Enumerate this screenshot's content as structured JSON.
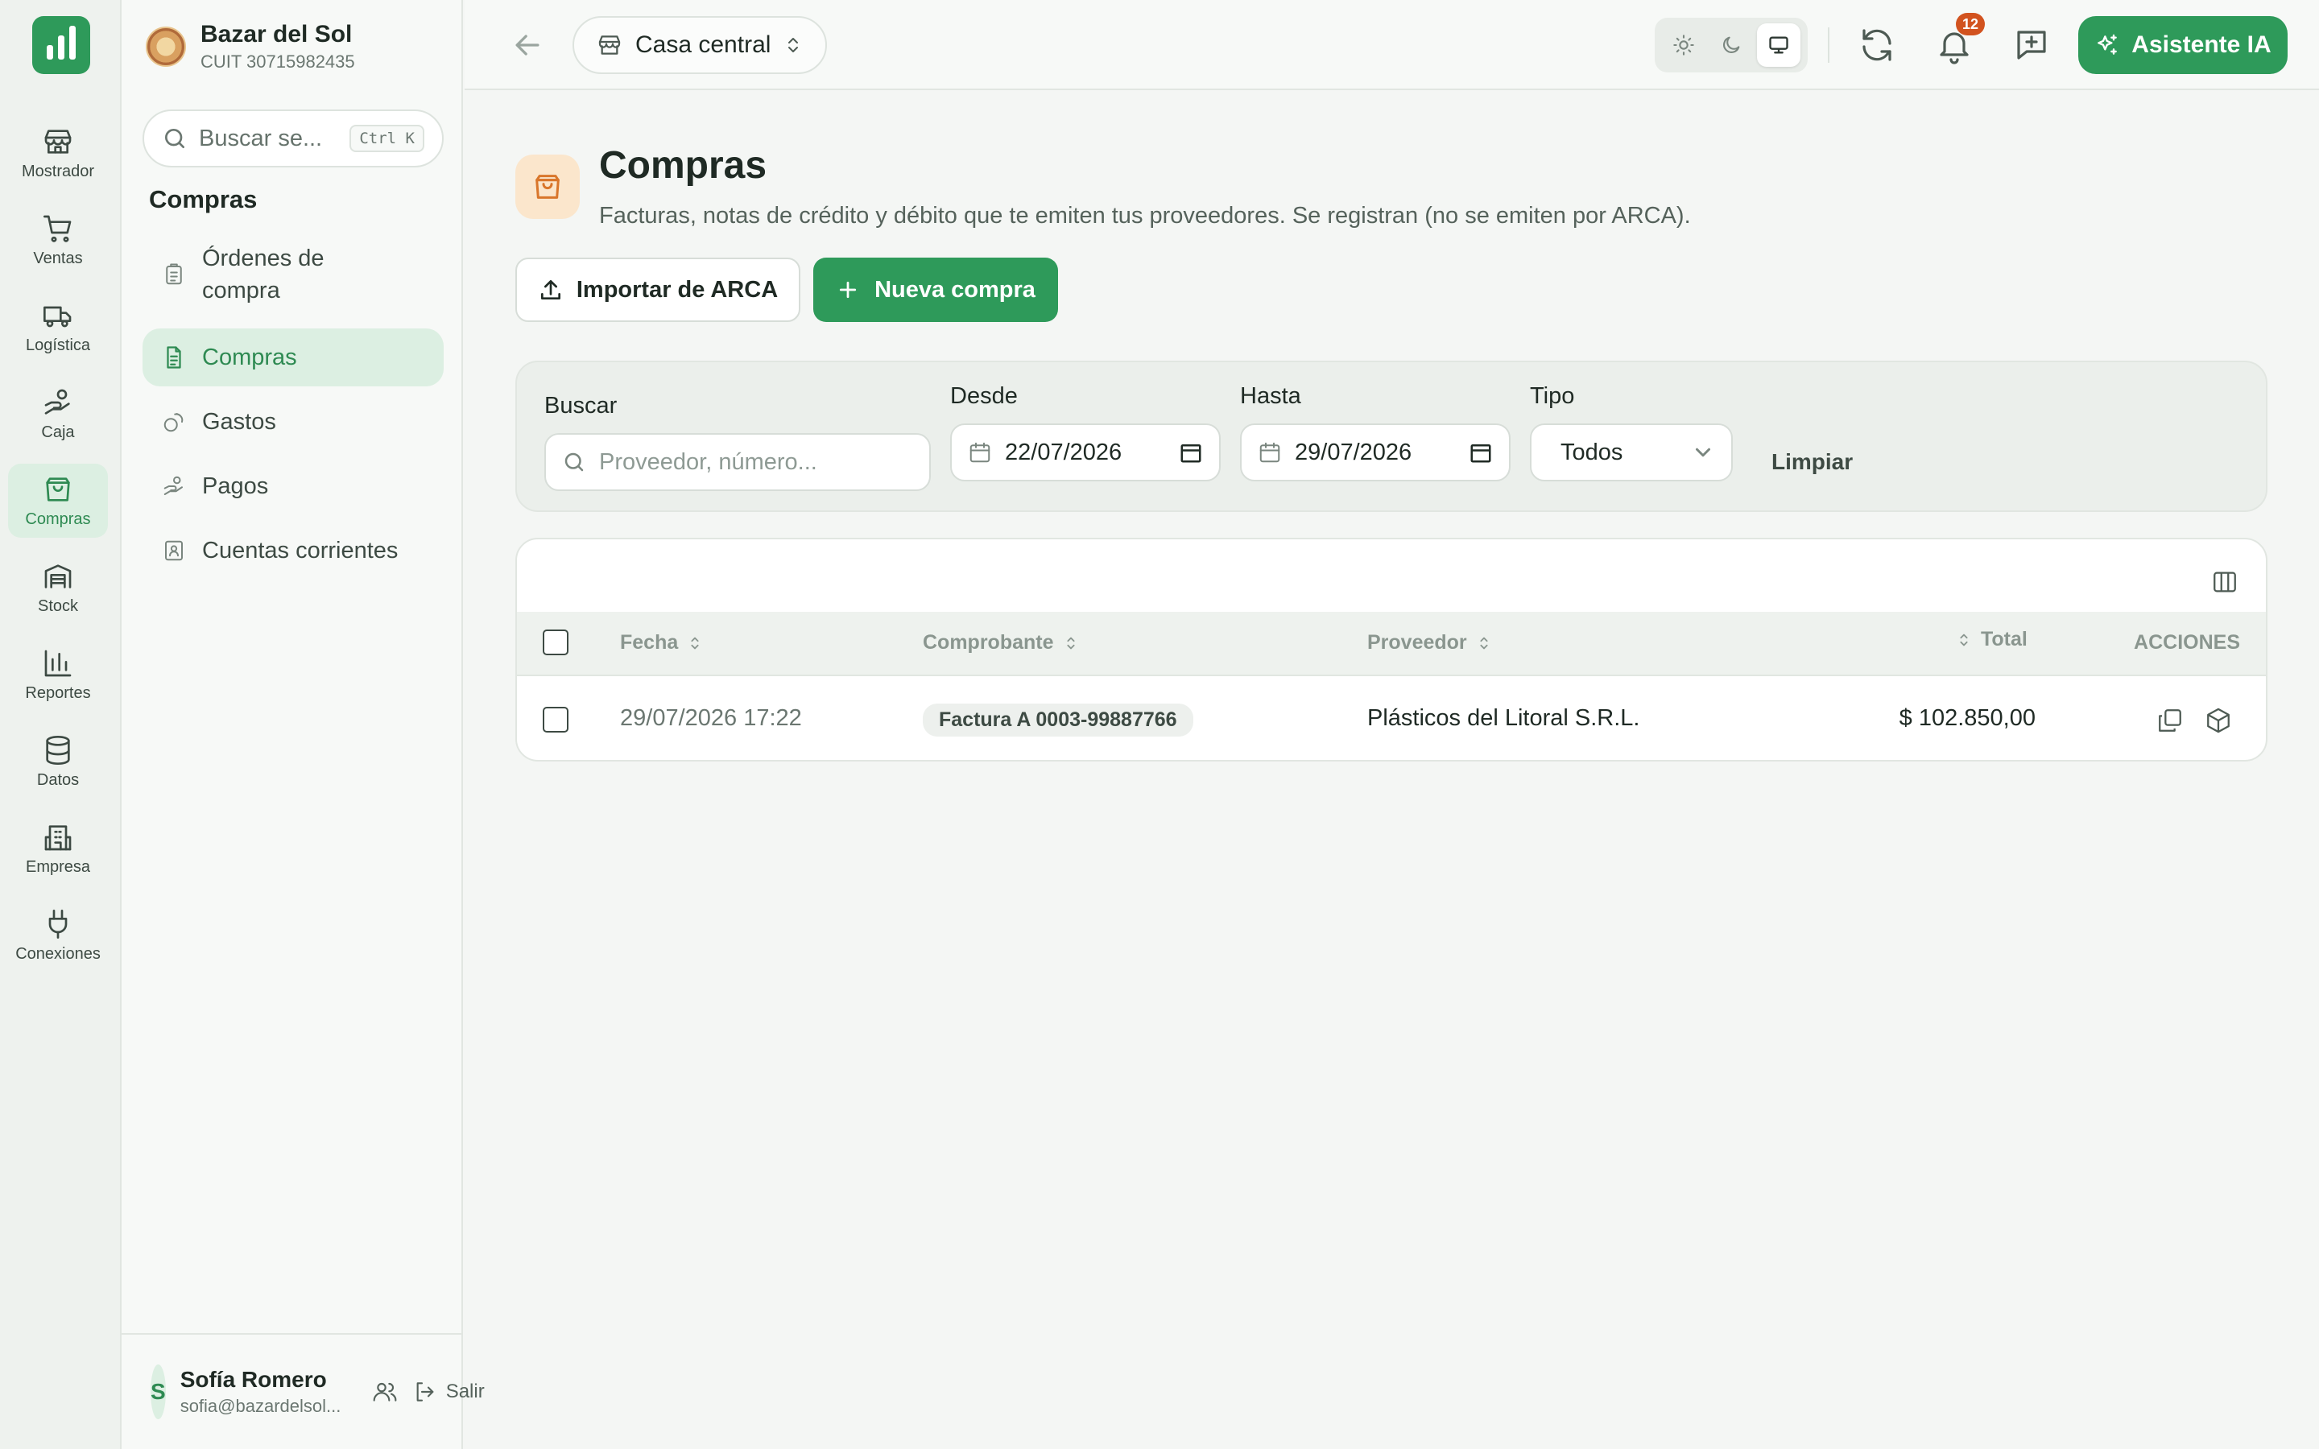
{
  "rail": {
    "items": [
      {
        "label": "Mostrador",
        "icon": "store-icon"
      },
      {
        "label": "Ventas",
        "icon": "cart-icon"
      },
      {
        "label": "Logística",
        "icon": "truck-icon"
      },
      {
        "label": "Caja",
        "icon": "hand-coins-icon"
      },
      {
        "label": "Compras",
        "icon": "shopping-bag-icon",
        "active": true
      },
      {
        "label": "Stock",
        "icon": "warehouse-icon"
      },
      {
        "label": "Reportes",
        "icon": "bar-chart-icon"
      },
      {
        "label": "Datos",
        "icon": "database-icon"
      },
      {
        "label": "Empresa",
        "icon": "building-icon"
      },
      {
        "label": "Conexiones",
        "icon": "plug-icon"
      }
    ]
  },
  "brand": {
    "name": "Bazar del Sol",
    "cuit": "CUIT 30715982435"
  },
  "sidebar": {
    "search_placeholder": "Buscar se...",
    "shortcut": "Ctrl K",
    "section_title": "Compras",
    "items": [
      {
        "label": "Órdenes de compra",
        "icon": "clipboard-icon"
      },
      {
        "label": "Compras",
        "icon": "file-text-icon",
        "active": true
      },
      {
        "label": "Gastos",
        "icon": "coins-icon"
      },
      {
        "label": "Pagos",
        "icon": "hand-coins-icon"
      },
      {
        "label": "Cuentas corrientes",
        "icon": "contact-book-icon"
      }
    ]
  },
  "user": {
    "initial": "S",
    "name": "Sofía Romero",
    "email": "sofia@bazardelsol...",
    "logout": "Salir"
  },
  "topbar": {
    "branch": "Casa central",
    "notifications_count": "12",
    "ai_button": "Asistente IA"
  },
  "page": {
    "title": "Compras",
    "subtitle": "Facturas, notas de crédito y débito que te emiten tus proveedores. Se registran (no se emiten por ARCA).",
    "import_button": "Importar de ARCA",
    "new_button": "Nueva compra"
  },
  "filters": {
    "search_label": "Buscar",
    "search_placeholder": "Proveedor, número...",
    "from_label": "Desde",
    "from_value": "22/07/2026",
    "to_label": "Hasta",
    "to_value": "29/07/2026",
    "type_label": "Tipo",
    "type_value": "Todos",
    "clear": "Limpiar"
  },
  "table": {
    "headers": {
      "date": "Fecha",
      "receipt": "Comprobante",
      "supplier": "Proveedor",
      "total": "Total",
      "actions": "ACCIONES"
    },
    "rows": [
      {
        "date": "29/07/2026 17:22",
        "receipt": "Factura A 0003-99887766",
        "supplier": "Plásticos del Litoral S.R.L.",
        "total": "$ 102.850,00"
      }
    ]
  },
  "colors": {
    "accent": "#2e9a5a",
    "accent_soft": "#dcefe2",
    "badge": "#d2531f",
    "page_icon_bg": "#fbe6cc"
  }
}
